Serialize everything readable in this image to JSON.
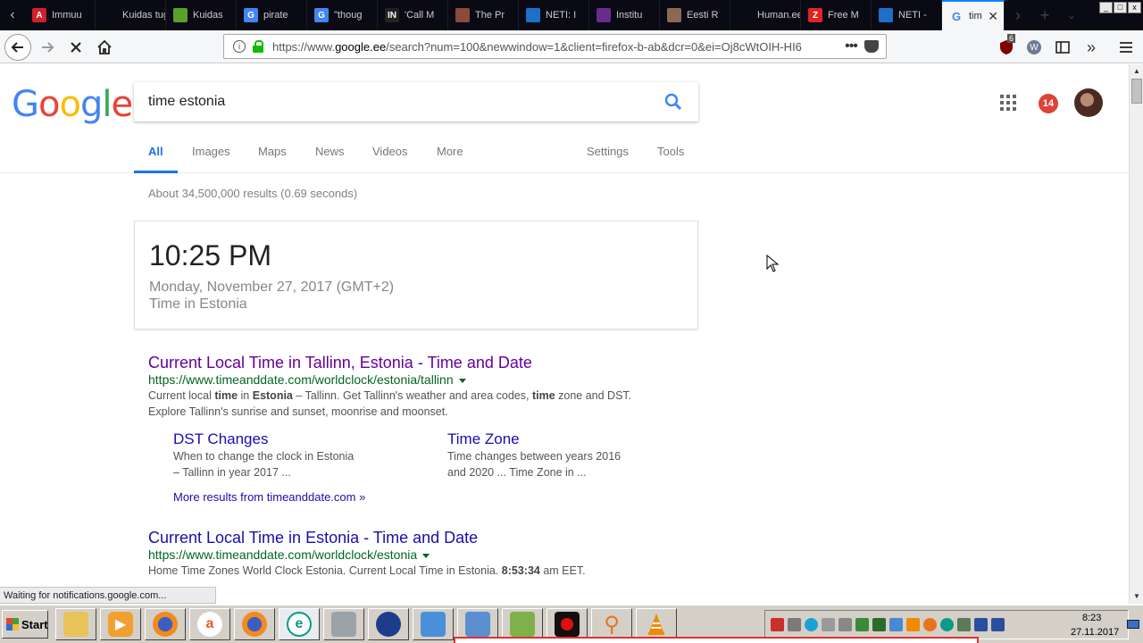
{
  "tabs": [
    {
      "label": "Immuu",
      "fav": "A",
      "color": "#d0202a"
    },
    {
      "label": "Kuidas tuge",
      "fav": "",
      "color": ""
    },
    {
      "label": "Kuidas",
      "fav": "",
      "color": "#5aa02c"
    },
    {
      "label": "pirate",
      "fav": "G",
      "color": "#4285f4"
    },
    {
      "label": "\"thoug",
      "fav": "G",
      "color": "#4285f4"
    },
    {
      "label": "'Call M",
      "fav": "IN",
      "color": "#222"
    },
    {
      "label": "The Pr",
      "fav": "",
      "color": "#8b4a3a"
    },
    {
      "label": "NETI: I",
      "fav": "",
      "color": "#1e6fc8"
    },
    {
      "label": "Institu",
      "fav": "",
      "color": "#6a2c8c"
    },
    {
      "label": "Eesti R",
      "fav": "",
      "color": "#8a6a55"
    },
    {
      "label": "Human.ee",
      "fav": "",
      "color": ""
    },
    {
      "label": "Free M",
      "fav": "Z",
      "color": "#e02424"
    },
    {
      "label": "NETI -",
      "fav": "",
      "color": "#1e6fc8"
    }
  ],
  "active_tab": {
    "label": "tim",
    "fav": "G"
  },
  "window_controls": [
    "_",
    "□",
    "x"
  ],
  "navbar": {
    "url_prefix": "https://www.",
    "url_host": "google.ee",
    "url_rest": "/search?num=100&newwindow=1&client=firefox-b-ab&dcr=0&ei=Oj8cWtOIH-HI6",
    "more": "•••",
    "ublock_count": "6"
  },
  "search": {
    "query": "time estonia",
    "notif_count": "14"
  },
  "result_tabs": {
    "all": "All",
    "images": "Images",
    "maps": "Maps",
    "news": "News",
    "videos": "Videos",
    "more": "More",
    "settings": "Settings",
    "tools": "Tools"
  },
  "stats": "About 34,500,000 results (0.69 seconds)",
  "time_card": {
    "time": "10:25 PM",
    "date": "Monday, November 27, 2017 (GMT+2)",
    "place": "Time in Estonia"
  },
  "results": [
    {
      "title": "Current Local Time in Tallinn, Estonia - Time and Date",
      "url": "https://www.timeanddate.com/worldclock/estonia/tallinn",
      "snippet_1": "Current local ",
      "snippet_b1": "time",
      "snippet_2": " in ",
      "snippet_b2": "Estonia",
      "snippet_3": " – Tallinn. Get Tallinn's weather and area codes, ",
      "snippet_b3": "time",
      "snippet_4": " zone and DST.",
      "snippet_line2": "Explore Tallinn's sunrise and sunset, moonrise and moonset."
    },
    {
      "title": "Current Local Time in Estonia - Time and Date",
      "url": "https://www.timeanddate.com/worldclock/estonia",
      "snippet_1": "Home Time Zones World Clock Estonia. Current Local Time in Estonia. ",
      "snippet_b1": "8:53:34",
      "snippet_2": " am EET."
    }
  ],
  "sitelinks": [
    {
      "title": "DST Changes",
      "line1": "When to change the clock in Estonia",
      "line2": "– Tallinn in year 2017 ..."
    },
    {
      "title": "Time Zone",
      "line1": "Time changes between years 2016",
      "line2": "and 2020 ... Time Zone in ..."
    }
  ],
  "more_results": "More results from timeanddate.com »",
  "status": "Waiting for notifications.google.com...",
  "taskbar": {
    "start": "Start",
    "clock_time": "8:23",
    "clock_date": "27.11.2017"
  },
  "colors": {
    "google_blue": "#4285f4",
    "google_red": "#ea4335",
    "google_yellow": "#fbbc05",
    "google_green": "#34a853",
    "link": "#1a0dab",
    "visited": "#660099",
    "url_green": "#006621"
  }
}
